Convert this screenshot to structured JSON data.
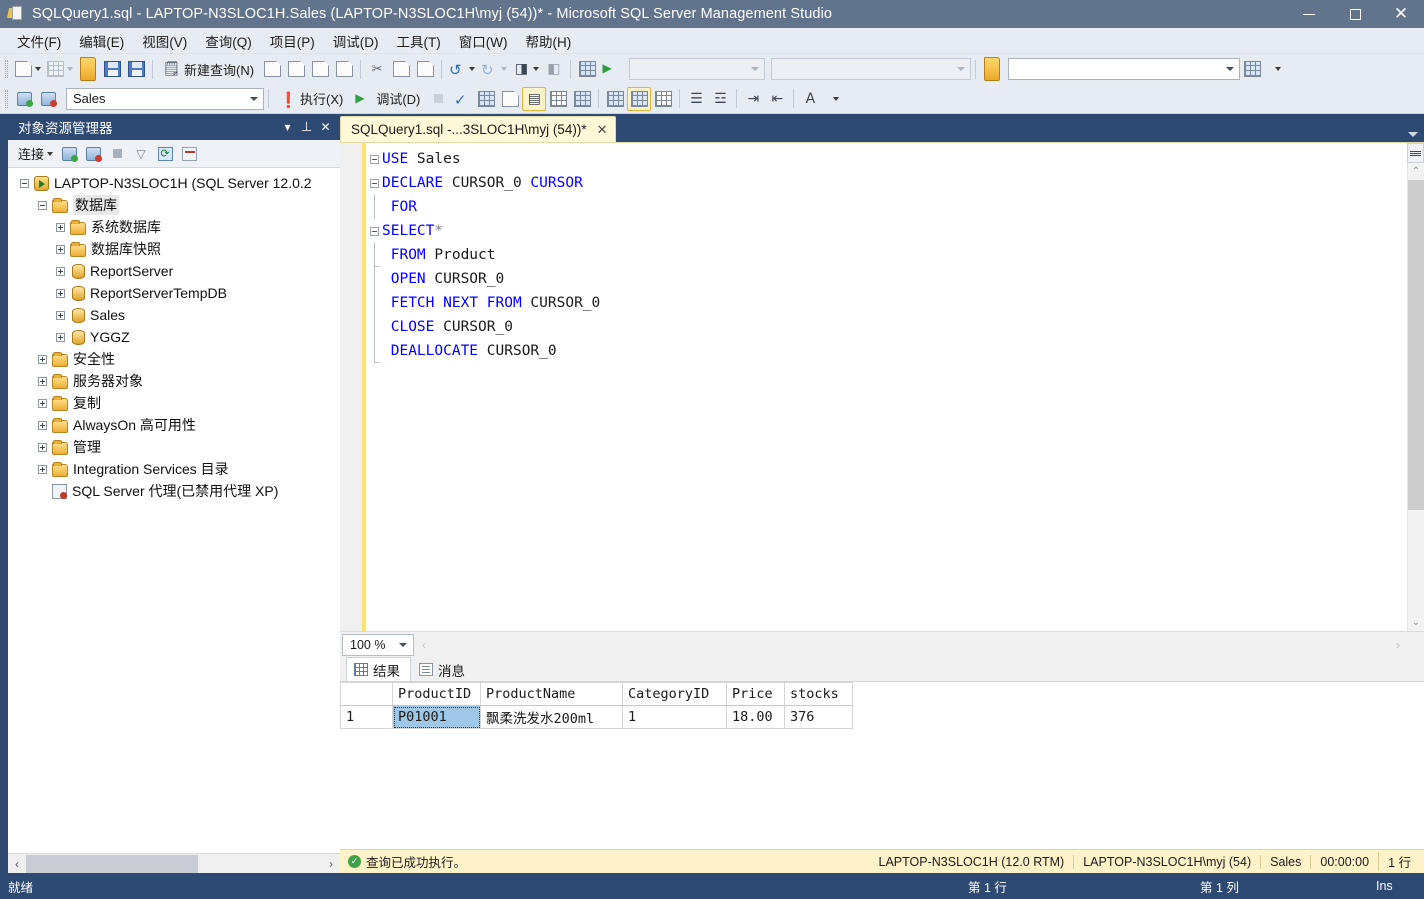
{
  "window": {
    "title": "SQLQuery1.sql - LAPTOP-N3SLOC1H.Sales (LAPTOP-N3SLOC1H\\myj (54))* - Microsoft SQL Server Management Studio",
    "app_icon": "sql-query-file-icon",
    "minimize": "—",
    "maximize": "□",
    "close": "✕"
  },
  "menu": {
    "items": [
      {
        "label": "文件(F)"
      },
      {
        "label": "编辑(E)"
      },
      {
        "label": "视图(V)"
      },
      {
        "label": "查询(Q)"
      },
      {
        "label": "项目(P)"
      },
      {
        "label": "调试(D)"
      },
      {
        "label": "工具(T)"
      },
      {
        "label": "窗口(W)"
      },
      {
        "label": "帮助(H)"
      }
    ]
  },
  "toolbar_main": {
    "new_query_label": "新建查询(N)",
    "icons": [
      "new-item-icon",
      "new-project-icon",
      "open-file-icon",
      "save-icon",
      "save-all-icon",
      "new-query-icon",
      "new-analysis-query-icon",
      "new-mdx-query-icon",
      "new-dmx-query-icon",
      "new-xmla-query-icon",
      "cut-icon",
      "copy-icon",
      "paste-icon",
      "undo-icon",
      "redo-icon",
      "navigate-backward-icon",
      "navigate-forward-icon",
      "activity-monitor-icon"
    ]
  },
  "toolbar_query": {
    "database_combo_value": "Sales",
    "execute_label": "执行(X)",
    "debug_label": "调试(D)",
    "combo_empty_1": "",
    "combo_empty_2": "",
    "combo_empty_3": ""
  },
  "object_explorer": {
    "title": "对象资源管理器",
    "connect_label": "连接",
    "toolbar_icons": [
      "connect-server-icon",
      "disconnect-server-icon",
      "stop-icon",
      "filter-icon",
      "refresh-icon",
      "script-icon"
    ],
    "tree": [
      {
        "label": "LAPTOP-N3SLOC1H (SQL Server 12.0.2",
        "indent": 0,
        "expander": "minus",
        "icon": "server-icon"
      },
      {
        "label": "数据库",
        "indent": 1,
        "expander": "minus",
        "icon": "folder-icon",
        "selected": true
      },
      {
        "label": "系统数据库",
        "indent": 2,
        "expander": "plus",
        "icon": "folder-icon"
      },
      {
        "label": "数据库快照",
        "indent": 2,
        "expander": "plus",
        "icon": "folder-icon"
      },
      {
        "label": "ReportServer",
        "indent": 2,
        "expander": "plus",
        "icon": "database-icon"
      },
      {
        "label": "ReportServerTempDB",
        "indent": 2,
        "expander": "plus",
        "icon": "database-icon"
      },
      {
        "label": "Sales",
        "indent": 2,
        "expander": "plus",
        "icon": "database-icon"
      },
      {
        "label": "YGGZ",
        "indent": 2,
        "expander": "plus",
        "icon": "database-icon"
      },
      {
        "label": "安全性",
        "indent": 1,
        "expander": "plus",
        "icon": "folder-icon"
      },
      {
        "label": "服务器对象",
        "indent": 1,
        "expander": "plus",
        "icon": "folder-icon"
      },
      {
        "label": "复制",
        "indent": 1,
        "expander": "plus",
        "icon": "folder-icon"
      },
      {
        "label": "AlwaysOn 高可用性",
        "indent": 1,
        "expander": "plus",
        "icon": "folder-icon"
      },
      {
        "label": "管理",
        "indent": 1,
        "expander": "plus",
        "icon": "folder-icon"
      },
      {
        "label": "Integration Services 目录",
        "indent": 1,
        "expander": "plus",
        "icon": "folder-icon"
      },
      {
        "label": "SQL Server 代理(已禁用代理 XP)",
        "indent": 1,
        "expander": "none",
        "icon": "agent-icon"
      }
    ]
  },
  "editor": {
    "tab_label": "SQLQuery1.sql -...3SLOC1H\\myj (54))*",
    "tab_close": "✕",
    "zoom_value": "100 %",
    "code_lines": [
      {
        "fold": "minus",
        "tokens": [
          {
            "t": "USE",
            "c": "kw"
          },
          {
            "t": " Sales",
            "c": "pl"
          }
        ]
      },
      {
        "fold": "minus",
        "tokens": [
          {
            "t": "DECLARE",
            "c": "kw"
          },
          {
            "t": " CURSOR_0 ",
            "c": "pl"
          },
          {
            "t": "CURSOR",
            "c": "kw"
          }
        ]
      },
      {
        "fold": "line",
        "tokens": [
          {
            "t": " ",
            "c": "pl"
          },
          {
            "t": "FOR",
            "c": "kw"
          }
        ]
      },
      {
        "fold": "minus",
        "tokens": [
          {
            "t": "SELECT",
            "c": "kw"
          },
          {
            "t": "*",
            "c": "op"
          }
        ]
      },
      {
        "fold": "lineend",
        "tokens": [
          {
            "t": " ",
            "c": "pl"
          },
          {
            "t": "FROM",
            "c": "kw"
          },
          {
            "t": " Product",
            "c": "pl"
          }
        ]
      },
      {
        "fold": "line",
        "tokens": [
          {
            "t": " ",
            "c": "pl"
          },
          {
            "t": "OPEN",
            "c": "kw"
          },
          {
            "t": " CURSOR_0",
            "c": "pl"
          }
        ]
      },
      {
        "fold": "line",
        "tokens": [
          {
            "t": " ",
            "c": "pl"
          },
          {
            "t": "FETCH",
            "c": "kw"
          },
          {
            "t": " ",
            "c": "pl"
          },
          {
            "t": "NEXT",
            "c": "kw"
          },
          {
            "t": " ",
            "c": "pl"
          },
          {
            "t": "FROM",
            "c": "kw"
          },
          {
            "t": " CURSOR_0",
            "c": "pl"
          }
        ]
      },
      {
        "fold": "line",
        "tokens": [
          {
            "t": " ",
            "c": "pl"
          },
          {
            "t": "CLOSE",
            "c": "kw"
          },
          {
            "t": " CURSOR_0",
            "c": "pl"
          }
        ]
      },
      {
        "fold": "lineend",
        "tokens": [
          {
            "t": " ",
            "c": "pl"
          },
          {
            "t": "DEALLOCATE",
            "c": "kw"
          },
          {
            "t": " CURSOR_0",
            "c": "pl"
          }
        ]
      }
    ]
  },
  "results": {
    "tabs": [
      {
        "label": "结果",
        "icon": "results-grid-icon",
        "active": true
      },
      {
        "label": "消息",
        "icon": "messages-icon",
        "active": false
      }
    ],
    "columns": [
      "",
      "ProductID",
      "ProductName",
      "CategoryID",
      "Price",
      "stocks"
    ],
    "rows": [
      {
        "num": "1",
        "ProductID": "P01001",
        "ProductName": "飘柔洗发水200ml",
        "CategoryID": "1",
        "Price": "18.00",
        "stocks": "376"
      }
    ]
  },
  "query_status": {
    "message": "查询已成功执行。",
    "server": "LAPTOP-N3SLOC1H (12.0 RTM)",
    "user": "LAPTOP-N3SLOC1H\\myj (54)",
    "database": "Sales",
    "elapsed": "00:00:00",
    "rows": "1 行"
  },
  "status_bar": {
    "ready": "就绪",
    "line": "第 1 行",
    "column": "第 1 列",
    "insert_mode": "Ins"
  }
}
